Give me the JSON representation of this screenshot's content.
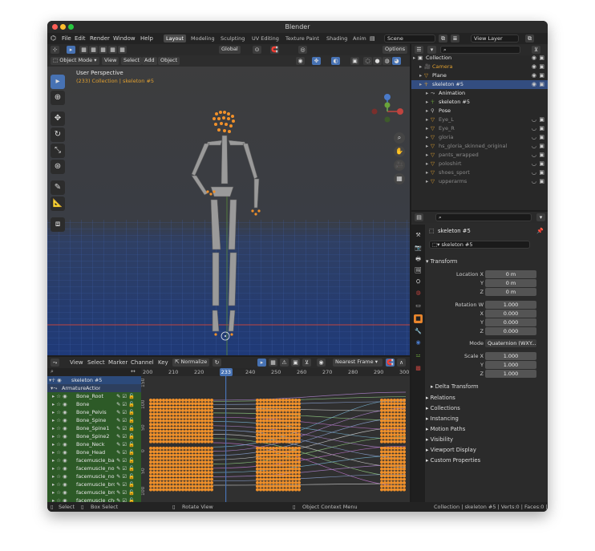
{
  "window": {
    "title": "Blender"
  },
  "menu": {
    "items": [
      "File",
      "Edit",
      "Render",
      "Window",
      "Help"
    ]
  },
  "workspaces": [
    {
      "label": "Layout",
      "active": true
    },
    {
      "label": "Modeling"
    },
    {
      "label": "Sculpting"
    },
    {
      "label": "UV Editing"
    },
    {
      "label": "Texture Paint"
    },
    {
      "label": "Shading"
    },
    {
      "label": "Anim"
    }
  ],
  "scene": {
    "name": "Scene"
  },
  "view_layer": {
    "name": "View Layer"
  },
  "tool_header": {
    "orientation": "Global",
    "options": "Options"
  },
  "viewport": {
    "mode": "Object Mode",
    "menu": [
      "View",
      "Select",
      "Add",
      "Object"
    ],
    "info_title": "User Perspective",
    "info_sub": "(233) Collection | skeleton #5"
  },
  "outliner": {
    "rows": [
      {
        "label": "Collection",
        "indent": 0,
        "type": "collection"
      },
      {
        "label": "Camera",
        "indent": 1,
        "type": "camera"
      },
      {
        "label": "Plane",
        "indent": 1,
        "type": "mesh"
      },
      {
        "label": "skeleton #5",
        "indent": 1,
        "type": "armature",
        "selected": true
      },
      {
        "label": "Animation",
        "indent": 2,
        "type": "anim"
      },
      {
        "label": "skeleton #5",
        "indent": 2,
        "type": "armature-data"
      },
      {
        "label": "Pose",
        "indent": 2,
        "type": "pose"
      },
      {
        "label": "Eye_L",
        "indent": 2,
        "type": "mesh",
        "dim": true
      },
      {
        "label": "Eye_R",
        "indent": 2,
        "type": "mesh",
        "dim": true
      },
      {
        "label": "gloria",
        "indent": 2,
        "type": "mesh",
        "dim": true
      },
      {
        "label": "hs_gloria_skinned_original",
        "indent": 2,
        "type": "mesh",
        "dim": true
      },
      {
        "label": "pants_wrapped",
        "indent": 2,
        "type": "mesh",
        "dim": true
      },
      {
        "label": "poloshirt",
        "indent": 2,
        "type": "mesh",
        "dim": true
      },
      {
        "label": "shoes_sport",
        "indent": 2,
        "type": "mesh",
        "dim": true
      },
      {
        "label": "upperarms",
        "indent": 2,
        "type": "mesh",
        "dim": true
      }
    ]
  },
  "properties": {
    "object_name": "skeleton #5",
    "data_name": "skeleton #5",
    "transform_title": "Transform",
    "location_label": "Location X",
    "location": [
      "0 m",
      "0 m",
      "0 m"
    ],
    "rotation_label": "Rotation W",
    "rotation": [
      "1.000",
      "0.000",
      "0.000",
      "0.000"
    ],
    "mode_label": "Mode",
    "mode_value": "Quaternion (WXY...",
    "scale_label": "Scale X",
    "scale": [
      "1.000",
      "1.000",
      "1.000"
    ],
    "axis_labels": [
      "Y",
      "Z",
      "X"
    ],
    "delta_title": "Delta Transform",
    "sections": [
      "Relations",
      "Collections",
      "Instancing",
      "Motion Paths",
      "Visibility",
      "Viewport Display",
      "Custom Properties"
    ]
  },
  "dopesheet": {
    "menu": [
      "View",
      "Select",
      "Marker",
      "Channel",
      "Key"
    ],
    "normalize": "Normalize",
    "snap": "Nearest Frame",
    "current_frame": "233",
    "frame_ticks": [
      "200",
      "210",
      "220",
      "230",
      "240",
      "250",
      "260",
      "270",
      "280",
      "290",
      "300"
    ],
    "channels": [
      {
        "label": "skeleton #5",
        "type": "obj"
      },
      {
        "label": "ArmatureAction",
        "type": "act"
      },
      {
        "label": "Bone_Root",
        "type": "bone"
      },
      {
        "label": "Bone",
        "type": "bone"
      },
      {
        "label": "Bone_Pelvis",
        "type": "bone"
      },
      {
        "label": "Bone_Spine",
        "type": "bone"
      },
      {
        "label": "Bone_Spine1",
        "type": "bone"
      },
      {
        "label": "Bone_Spine2",
        "type": "bone"
      },
      {
        "label": "Bone_Neck",
        "type": "bone"
      },
      {
        "label": "Bone_Head",
        "type": "bone"
      },
      {
        "label": "facemuscle_bas",
        "type": "bone"
      },
      {
        "label": "facemuscle_nos",
        "type": "bone"
      },
      {
        "label": "facemuscle_nos",
        "type": "bone"
      },
      {
        "label": "facemuscle_bro",
        "type": "bone"
      },
      {
        "label": "facemuscle_bro",
        "type": "bone"
      },
      {
        "label": "facemuscle_che",
        "type": "bone"
      },
      {
        "label": "facemuscle_bro",
        "type": "bone"
      },
      {
        "label": "facemuscle_nos",
        "type": "bone"
      }
    ],
    "side_values": [
      "150",
      "100",
      "50",
      "0",
      "50",
      "100"
    ]
  },
  "status": {
    "select": "Select",
    "box_select": "Box Select",
    "rotate": "Rotate View",
    "context": "Object Context Menu",
    "info": "Collection | skeleton #5 | Verts:0 | Faces:0 | Tri"
  },
  "colors": {
    "accent": "#4772b3",
    "keyframe": "#f0902a",
    "bone_row": "#2d5a27",
    "selected_row": "#334d80"
  }
}
